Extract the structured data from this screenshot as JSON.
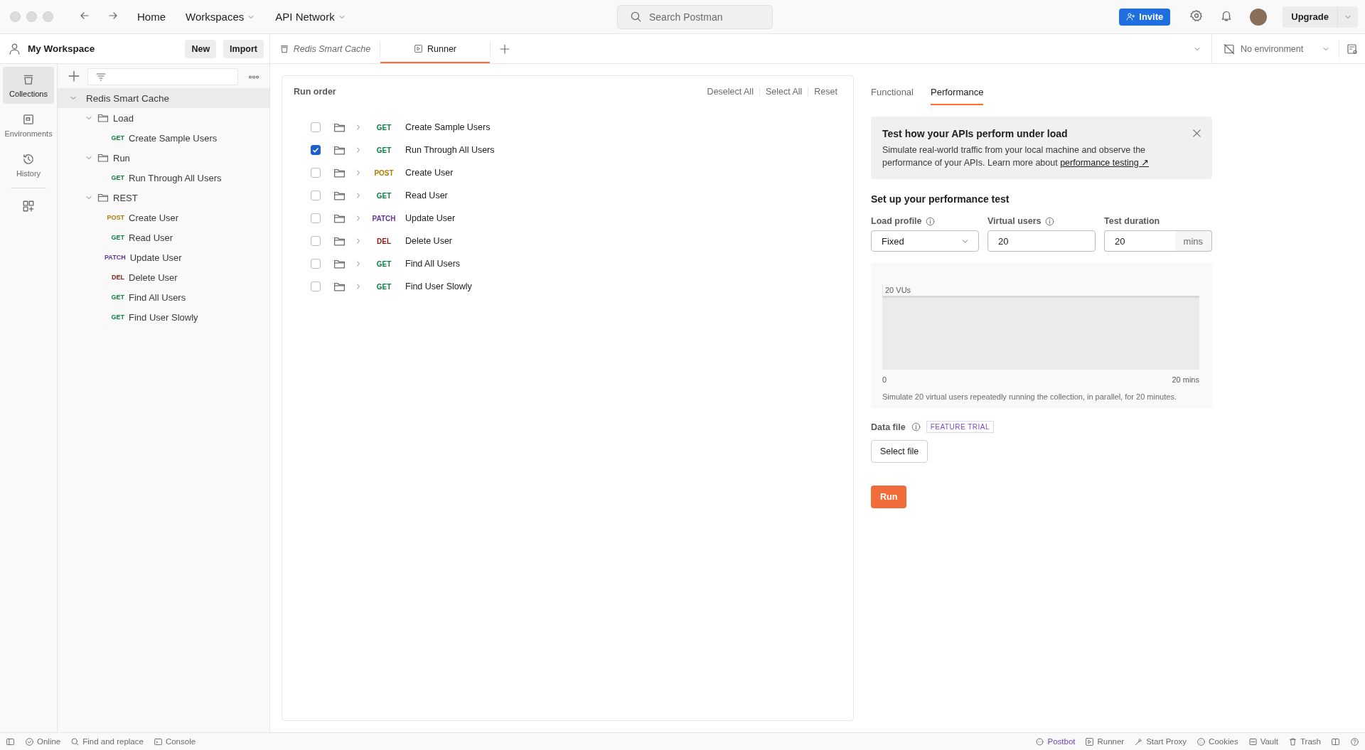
{
  "topbar": {
    "nav": [
      {
        "label": "Home",
        "dropdown": false
      },
      {
        "label": "Workspaces",
        "dropdown": true
      },
      {
        "label": "API Network",
        "dropdown": true
      }
    ],
    "search": {
      "placeholder": "Search Postman"
    },
    "invite": "Invite",
    "upgrade": "Upgrade"
  },
  "sidebar": {
    "workspace": "My Workspace",
    "buttons": [
      "New",
      "Import"
    ],
    "rail": [
      {
        "label": "Collections",
        "selected": true
      },
      {
        "label": "Environments",
        "selected": false
      },
      {
        "label": "History",
        "selected": false
      }
    ],
    "tree": [
      {
        "name": "Redis Smart Cache",
        "expanded": true,
        "children": [
          {
            "kind": "folder",
            "name": "Load",
            "expanded": true,
            "children": [
              {
                "kind": "request",
                "method": "GET",
                "color": "#0b8043",
                "name": "Create Sample Users"
              }
            ]
          },
          {
            "kind": "folder",
            "name": "Run",
            "expanded": true,
            "children": [
              {
                "kind": "request",
                "method": "GET",
                "color": "#0b8043",
                "name": "Run Through All Users"
              }
            ]
          },
          {
            "kind": "folder",
            "name": "REST",
            "expanded": true,
            "children": [
              {
                "kind": "request",
                "method": "POST",
                "color": "#ad7a03",
                "name": "Create User"
              },
              {
                "kind": "request",
                "method": "GET",
                "color": "#0b8043",
                "name": "Read User"
              },
              {
                "kind": "request",
                "method": "PATCH",
                "color": "#623497",
                "name": "Update User"
              },
              {
                "kind": "request",
                "method": "DEL",
                "color": "#8e1a10",
                "name": "Delete User"
              },
              {
                "kind": "request",
                "method": "GET",
                "color": "#0b8043",
                "name": "Find All Users"
              },
              {
                "kind": "request",
                "method": "GET",
                "color": "#0b8043",
                "name": "Find User Slowly"
              }
            ]
          }
        ]
      }
    ]
  },
  "tabs": [
    {
      "label": "Redis Smart Cache",
      "selected": false,
      "preview": true
    },
    {
      "label": "Runner",
      "selected": true,
      "preview": false
    }
  ],
  "environment": "No environment",
  "run_order": {
    "title": "Run order",
    "actions": [
      "Deselect All",
      "Select All",
      "Reset"
    ],
    "items": [
      {
        "checked": false,
        "method": "GET",
        "color": "#0b8043",
        "name": "Create Sample Users"
      },
      {
        "checked": true,
        "method": "GET",
        "color": "#0b8043",
        "name": "Run Through All Users"
      },
      {
        "checked": false,
        "method": "POST",
        "color": "#ad7a03",
        "name": "Create User"
      },
      {
        "checked": false,
        "method": "GET",
        "color": "#0b8043",
        "name": "Read User"
      },
      {
        "checked": false,
        "method": "PATCH",
        "color": "#623497",
        "name": "Update User"
      },
      {
        "checked": false,
        "method": "DEL",
        "color": "#8e1a10",
        "name": "Delete User"
      },
      {
        "checked": false,
        "method": "GET",
        "color": "#0b8043",
        "name": "Find All Users"
      },
      {
        "checked": false,
        "method": "GET",
        "color": "#0b8043",
        "name": "Find User Slowly"
      }
    ]
  },
  "config": {
    "tabs": [
      {
        "label": "Functional",
        "selected": false
      },
      {
        "label": "Performance",
        "selected": true
      }
    ],
    "banner": {
      "title": "Test how your APIs perform under load",
      "text": "Simulate real-world traffic from your local machine and observe the performance of your APIs. Learn more about ",
      "link": "performance testing ↗"
    },
    "heading": "Set up your performance test",
    "fields": [
      {
        "kind": "select",
        "label": "Load profile",
        "info": true,
        "value": "Fixed"
      },
      {
        "kind": "input",
        "label": "Virtual users",
        "info": true,
        "value": "20"
      },
      {
        "kind": "input",
        "label": "Test duration",
        "info": false,
        "value": "20",
        "suffix": "mins"
      }
    ],
    "load_chart": {
      "peak_label": "20 VUs",
      "x_start": "0",
      "x_end": "20 mins"
    },
    "chart_caption": "Simulate 20 virtual users repeatedly running the collection, in parallel, for 20 minutes.",
    "data_file": {
      "label": "Data file",
      "info": true,
      "badge": "FEATURE TRIAL",
      "button": "Select file"
    },
    "run": "Run"
  },
  "status_bar": {
    "left": [
      "Online",
      "Find and replace",
      "Console"
    ],
    "right": [
      {
        "label": "Postbot",
        "color": "#6b45bc"
      },
      {
        "label": "Runner",
        "color": "#6b6b6b"
      },
      {
        "label": "Start Proxy",
        "color": "#6b6b6b"
      },
      {
        "label": "Cookies",
        "color": "#6b6b6b"
      },
      {
        "label": "Vault",
        "color": "#6b6b6b"
      },
      {
        "label": "Trash",
        "color": "#6b6b6b"
      }
    ]
  }
}
